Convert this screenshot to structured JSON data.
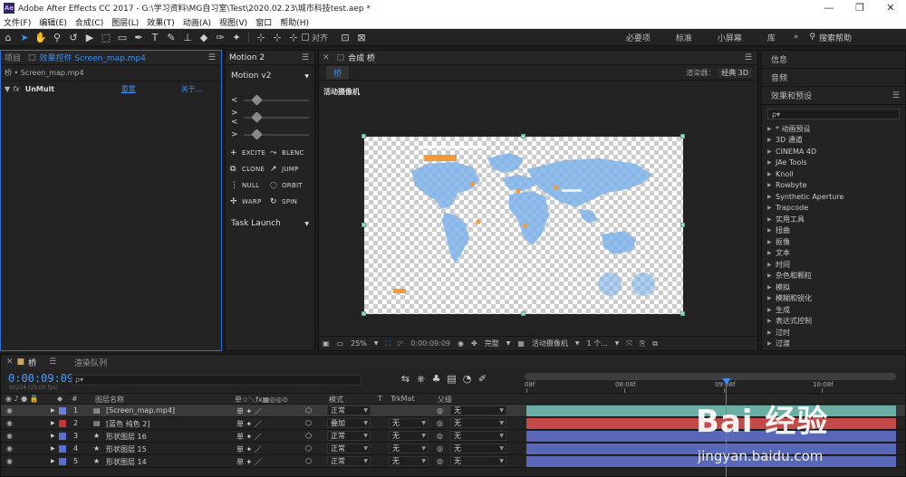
{
  "window": {
    "title": "Adobe After Effects CC 2017 - G:\\学习资料\\MG自习室\\Test\\2020.02.23\\城市科技test.aep *",
    "logo": "Ae",
    "controls": [
      "—",
      "❐",
      "✕"
    ]
  },
  "menu": [
    "文件(F)",
    "编辑(E)",
    "合成(C)",
    "图层(L)",
    "效果(T)",
    "动画(A)",
    "视图(V)",
    "窗口",
    "帮助(H)"
  ],
  "toolbar": {
    "align_label": "对齐",
    "workspaces": [
      "必要项",
      "标准",
      "小屏幕",
      "库"
    ],
    "more": "»",
    "search_help": "搜索帮助"
  },
  "project_panel": {
    "tabs": {
      "project": "项目",
      "effect_controls": "效果控件 Screen_map.mp4"
    },
    "breadcrumb": "桥 • Screen_map.mp4",
    "effect": {
      "name": "UnMult",
      "reset": "重置",
      "about": "关于..."
    }
  },
  "motion_panel": {
    "tab": "Motion 2",
    "version": "Motion v2",
    "sliders": [
      {
        "label": "<"
      },
      {
        "label": "><"
      },
      {
        "label": ">"
      }
    ],
    "buttons": [
      {
        "icon": "+",
        "label": "EXCITE"
      },
      {
        "icon": "⤳",
        "label": "BLENC"
      },
      {
        "icon": "⧉",
        "label": "CLONE"
      },
      {
        "icon": "↗",
        "label": "JUMP"
      },
      {
        "icon": "⋮",
        "label": "NULL"
      },
      {
        "icon": "◌",
        "label": "ORBIT"
      },
      {
        "icon": "✢",
        "label": "WARP"
      },
      {
        "icon": "↻",
        "label": "SPIN"
      }
    ],
    "task_launch": "Task Launch"
  },
  "comp_panel": {
    "tab": "合成 桥",
    "bridge_tab": "桥",
    "renderer_label": "渲染器：",
    "renderer": "经典 3D",
    "camera_label": "活动摄像机",
    "footer": {
      "zoom": "25%",
      "timecode": "0:00:09:09",
      "quality": "完整",
      "camera": "活动摄像机",
      "views": "1 个..."
    }
  },
  "right_panel": {
    "info": "信息",
    "audio": "音频",
    "effects_title": "效果和预设",
    "search_placeholder": "ρ▾",
    "categories": [
      "* 动画预设",
      "3D 通道",
      "CINEMA 4D",
      "JAe Tools",
      "Knoll",
      "Rowbyte",
      "Synthetic Aperture",
      "Trapcode",
      "实用工具",
      "扭曲",
      "抠像",
      "文本",
      "时间",
      "杂色和颗粒",
      "模拟",
      "模糊和锐化",
      "生成",
      "表达式控制",
      "过时",
      "过渡"
    ]
  },
  "timeline": {
    "tabs": {
      "comp": "桥",
      "render_queue": "渲染队列"
    },
    "timecode": "0:00:09:09",
    "fps": "00234 (25.00 fps)",
    "search_placeholder": "ρ▾",
    "ruler": [
      "08f",
      "08:08f",
      "09:08f",
      "10:08f"
    ],
    "headers": {
      "layer_name": "图层名称",
      "mode": "模式",
      "t": "T",
      "trkmat": "TrkMat",
      "parent": "父级",
      "switches": "单☆＼fx▦◎◎⊙"
    },
    "layers": [
      {
        "num": "1",
        "name": "[Screen_map.mp4]",
        "color": "#6d7fd6",
        "mode": "正常",
        "trkmat": "",
        "parent": "无",
        "bar": "#6aaea4",
        "selected": true
      },
      {
        "num": "2",
        "name": "[蓝色 纯色 2]",
        "color": "#c23535",
        "mode": "叠加",
        "trkmat": "无",
        "parent": "无",
        "bar": "#c44a4a",
        "selected": false
      },
      {
        "num": "3",
        "name": "形状图层 16",
        "color": "#5b6fd1",
        "mode": "正常",
        "trkmat": "无",
        "parent": "无",
        "bar": "#5867b8",
        "selected": false
      },
      {
        "num": "4",
        "name": "形状图层 15",
        "color": "#5b6fd1",
        "mode": "正常",
        "trkmat": "无",
        "parent": "无",
        "bar": "#5867b8",
        "selected": false
      },
      {
        "num": "5",
        "name": "形状图层 14",
        "color": "#5b6fd1",
        "mode": "正常",
        "trkmat": "无",
        "parent": "无",
        "bar": "#5867b8",
        "selected": false
      }
    ]
  },
  "watermark": {
    "brand": "Bai 经验",
    "url": "jingyan.baidu.com"
  }
}
